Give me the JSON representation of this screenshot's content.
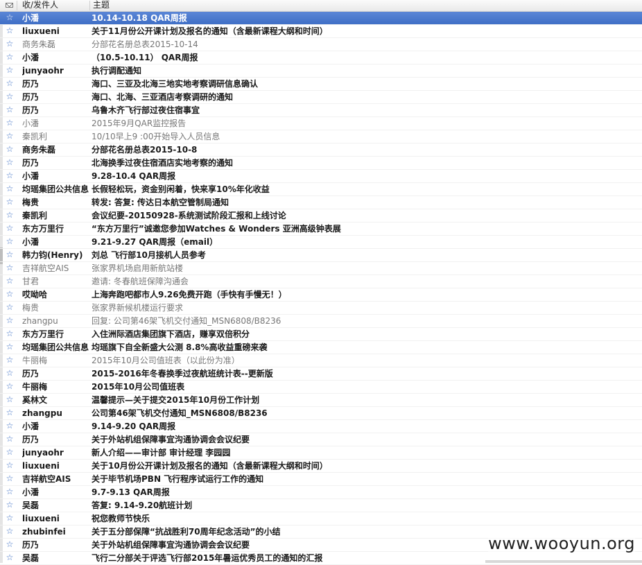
{
  "header": {
    "from_label": "收/发件人",
    "subject_label": "主题"
  },
  "colors": {
    "selected_bg": "#4a78cc",
    "star": "#3b6ec4"
  },
  "icons": {
    "column_icon": "envelope-icon",
    "row_icon": "star-icon"
  },
  "messages": [
    {
      "sender": "小潘",
      "subject": "10.14-10.18 QAR周报",
      "state": "selected"
    },
    {
      "sender": "liuxueni",
      "subject": "关于11月份公开课计划及报名的通知（含最新课程大纲和时间）",
      "state": "unread"
    },
    {
      "sender": "商务朱磊",
      "subject": "分部花名册总表2015-10-14",
      "state": "read"
    },
    {
      "sender": "小潘",
      "subject": "（10.5-10.11） QAR周报",
      "state": "unread"
    },
    {
      "sender": "junyaohr",
      "subject": "执行调配通知",
      "state": "unread"
    },
    {
      "sender": "历乃",
      "subject": "海口、三亚及北海三地实地考察调研信息确认",
      "state": "unread"
    },
    {
      "sender": "历乃",
      "subject": "海口、北海、三亚酒店考察调研的通知",
      "state": "unread"
    },
    {
      "sender": "历乃",
      "subject": "乌鲁木齐飞行部过夜住宿事宜",
      "state": "unread"
    },
    {
      "sender": "小潘",
      "subject": "2015年9月QAR监控报告",
      "state": "read"
    },
    {
      "sender": "秦凯利",
      "subject": "10/10早上9 :00开始导入人员信息",
      "state": "read"
    },
    {
      "sender": "商务朱磊",
      "subject": "分部花名册总表2015-10-8",
      "state": "unread"
    },
    {
      "sender": "历乃",
      "subject": "北海换季过夜住宿酒店实地考察的通知",
      "state": "unread"
    },
    {
      "sender": "小潘",
      "subject": "9.28-10.4 QAR周报",
      "state": "unread"
    },
    {
      "sender": "均瑶集团公共信息",
      "subject": "长假轻松玩，资金别闲着，快来享10%年化收益",
      "state": "unread"
    },
    {
      "sender": "梅贵",
      "subject": "转发: 答复: 传达日本航空管制局通知",
      "state": "unread"
    },
    {
      "sender": "秦凯利",
      "subject": "会议纪要-20150928-系统测试阶段汇报和上线讨论",
      "state": "unread"
    },
    {
      "sender": "东方万里行",
      "subject": "“东方万里行”诚邀您参加Watches & Wonders 亚洲高级钟表展",
      "state": "unread"
    },
    {
      "sender": "小潘",
      "subject": "9.21-9.27 QAR周报（email）",
      "state": "unread"
    },
    {
      "sender": "韩力钧(Henry)",
      "subject": "刘总 飞行部10月接机人员参考",
      "state": "unread"
    },
    {
      "sender": "吉祥航空AIS",
      "subject": "张家界机场启用新航站楼",
      "state": "read"
    },
    {
      "sender": "甘君",
      "subject": "邀请: 冬春航班保障沟通会",
      "state": "read"
    },
    {
      "sender": "哎呦哈",
      "subject": "上海奔跑吧都市人9.26免费开跑（手快有手慢无！）",
      "state": "unread"
    },
    {
      "sender": "梅贵",
      "subject": "张家界新候机楼运行要求",
      "state": "read"
    },
    {
      "sender": "zhangpu",
      "subject": "回复: 公司第46架飞机交付通知_MSN6808/B8236",
      "state": "read"
    },
    {
      "sender": "东方万里行",
      "subject": "入住洲际酒店集团旗下酒店，赚享双倍积分",
      "state": "unread"
    },
    {
      "sender": "均瑶集团公共信息",
      "subject": "均瑶旗下自全新盛大公测 8.8%高收益重磅来袭",
      "state": "unread"
    },
    {
      "sender": "牛丽梅",
      "subject": "2015年10月公司值班表（以此份为准）",
      "state": "read"
    },
    {
      "sender": "历乃",
      "subject": " 2015-2016年冬春换季过夜航班统计表--更新版",
      "state": "unread"
    },
    {
      "sender": "牛丽梅",
      "subject": "2015年10月公司值班表",
      "state": "unread"
    },
    {
      "sender": "奚林文",
      "subject": "温馨提示—关于提交2015年10月份工作计划",
      "state": "unread"
    },
    {
      "sender": "zhangpu",
      "subject": "公司第46架飞机交付通知_MSN6808/B8236",
      "state": "unread"
    },
    {
      "sender": "小潘",
      "subject": "9.14-9.20 QAR周报",
      "state": "unread"
    },
    {
      "sender": "历乃",
      "subject": "关于外站机组保障事宜沟通协调会会议纪要",
      "state": "unread"
    },
    {
      "sender": "junyaohr",
      "subject": "新人介绍——审计部 审计经理 李园园",
      "state": "unread"
    },
    {
      "sender": "liuxueni",
      "subject": "关于10月份公开课计划及报名的通知（含最新课程大纲和时间）",
      "state": "unread"
    },
    {
      "sender": "吉祥航空AIS",
      "subject": "关于毕节机场PBN 飞行程序试运行工作的通知",
      "state": "unread"
    },
    {
      "sender": "小潘",
      "subject": "9.7-9.13 QAR周报",
      "state": "unread"
    },
    {
      "sender": "吴磊",
      "subject": "答复: 9.14-9.20航班计划",
      "state": "unread"
    },
    {
      "sender": "liuxueni",
      "subject": "祝您教师节快乐",
      "state": "unread"
    },
    {
      "sender": "zhubinfei",
      "subject": "关于五分部保障“抗战胜利70周年纪念活动”的小结",
      "state": "unread"
    },
    {
      "sender": "历乃",
      "subject": "关于外站机组保障事宜沟通协调会会议纪要",
      "state": "unread"
    },
    {
      "sender": "吴磊",
      "subject": "飞行二分部关于评选飞行部2015年暑运优秀员工的通知的汇报",
      "state": "unread"
    }
  ],
  "watermark": "www.wooyun.org"
}
